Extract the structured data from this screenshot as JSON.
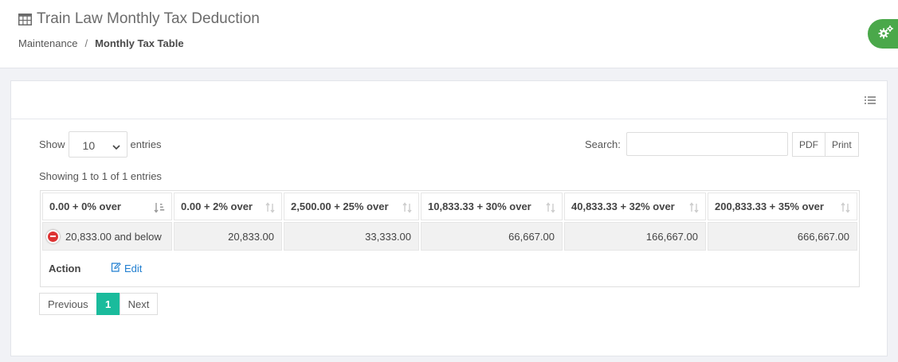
{
  "header": {
    "title": "Train Law Monthly Tax Deduction",
    "title_icon": "table-icon",
    "breadcrumb": {
      "parent": "Maintenance",
      "separator": "/",
      "current": "Monthly Tax Table"
    }
  },
  "settings_toggle": {
    "icon": "cogs-icon",
    "color": "#4aa84a"
  },
  "card": {
    "tool_icon": "list-icon",
    "length": {
      "label_before": "Show",
      "value": "10",
      "label_after": "entries"
    },
    "search": {
      "label": "Search:",
      "value": ""
    },
    "buttons": {
      "pdf": "PDF",
      "print": "Print"
    },
    "info": "Showing 1 to 1 of 1 entries",
    "table": {
      "columns": [
        "0.00 + 0% over",
        "0.00 + 2% over",
        "2,500.00 + 25% over",
        "10,833.33 + 30% over",
        "40,833.33 + 32% over",
        "200,833.33 + 35% over"
      ],
      "rows": [
        [
          "20,833.00 and below",
          "20,833.00",
          "33,333.00",
          "66,667.00",
          "166,667.00",
          "666,667.00"
        ]
      ],
      "child": {
        "label": "Action",
        "edit": "Edit"
      }
    },
    "pagination": {
      "previous": "Previous",
      "current": "1",
      "next": "Next",
      "active_color": "#1abb9c"
    }
  }
}
